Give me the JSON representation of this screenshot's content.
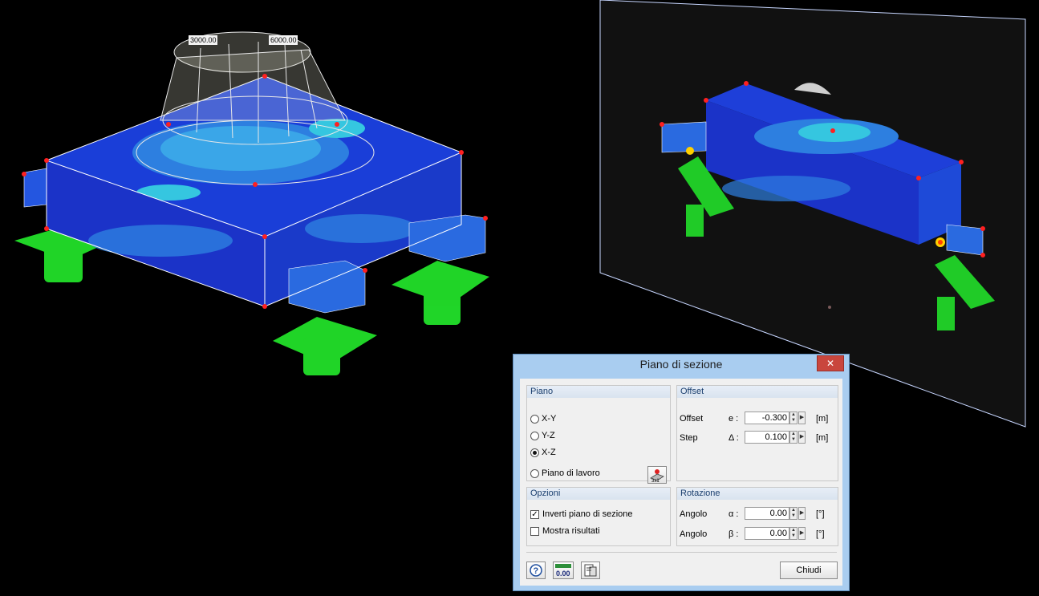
{
  "viewport": {
    "dimension_labels": [
      "3000.00",
      "6000.00"
    ],
    "colors": {
      "background": "#000000",
      "slab_base": "#1a3ed8",
      "contour_light": "#35c6e0",
      "support": "#22e02a",
      "node": "#ff2020"
    }
  },
  "dialog": {
    "title": "Piano di sezione",
    "close_icon": "close-icon",
    "piano": {
      "header": "Piano",
      "options": [
        "X-Y",
        "Y-Z",
        "X-Z",
        "Piano di lavoro"
      ],
      "selected": "X-Z",
      "workplane_button_icon": "workplane-icon"
    },
    "offset": {
      "header": "Offset",
      "offset_label": "Offset",
      "offset_symbol": "e :",
      "offset_value": "-0.300",
      "offset_unit": "[m]",
      "step_label": "Step",
      "step_symbol": "Δ :",
      "step_value": "0.100",
      "step_unit": "[m]"
    },
    "opzioni": {
      "header": "Opzioni",
      "invert_label": "Inverti piano di sezione",
      "invert_checked": true,
      "show_results_label": "Mostra risultati",
      "show_results_checked": false
    },
    "rotazione": {
      "header": "Rotazione",
      "alpha_label": "Angolo",
      "alpha_symbol": "α :",
      "alpha_value": "0.00",
      "alpha_unit": "[°]",
      "beta_label": "Angolo",
      "beta_symbol": "β :",
      "beta_value": "0.00",
      "beta_unit": "[°]"
    },
    "footer": {
      "help_icon": "help-icon",
      "decimals_icon": "decimals-icon",
      "decimals_text": "0.00",
      "units_icon": "units-icon",
      "close_button": "Chiudi"
    }
  }
}
